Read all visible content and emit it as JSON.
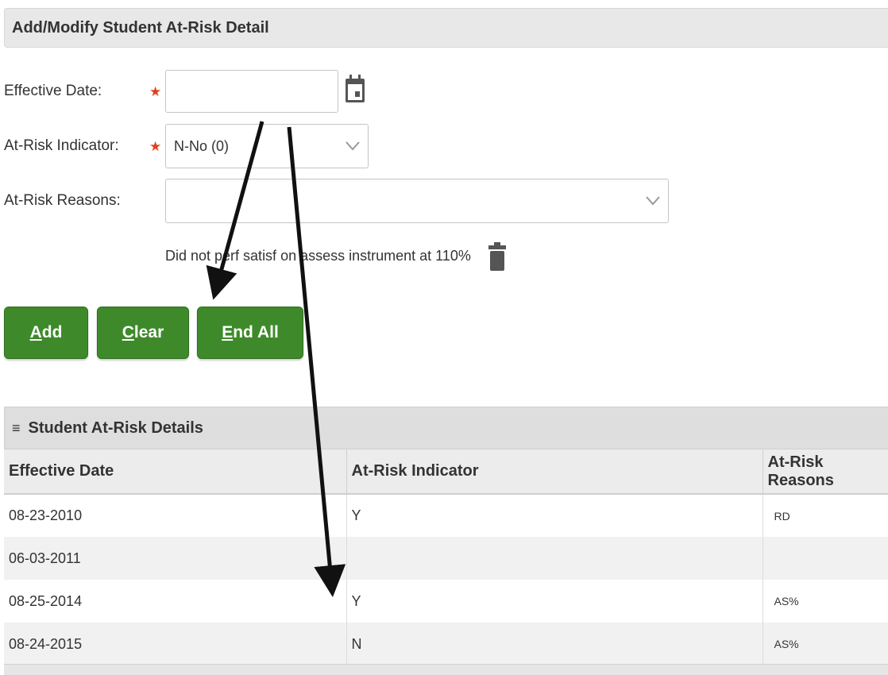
{
  "form": {
    "title": "Add/Modify Student At-Risk Detail",
    "effective_date": {
      "label": "Effective Date:",
      "value": ""
    },
    "indicator": {
      "label": "At-Risk Indicator:",
      "value": "N-No (0)"
    },
    "reasons": {
      "label": "At-Risk Reasons:",
      "value": "",
      "selected_reason": "Did not perf satisf on assess instrument at 110%"
    },
    "required_mark": "★"
  },
  "buttons": {
    "add": {
      "first": "A",
      "rest": "dd"
    },
    "clear": {
      "first": "C",
      "rest": "lear"
    },
    "end_all": {
      "first": "E",
      "rest": "nd All"
    }
  },
  "grid": {
    "title": "Student At-Risk Details",
    "menu_icon": "≡",
    "columns": [
      "Effective Date",
      "At-Risk Indicator",
      "At-Risk Reasons"
    ],
    "rows": [
      {
        "date": "08-23-2010",
        "indicator": "Y",
        "reasons": "RD"
      },
      {
        "date": "06-03-2011",
        "indicator": "",
        "reasons": ""
      },
      {
        "date": "08-25-2014",
        "indicator": "Y",
        "reasons": "AS%"
      },
      {
        "date": "08-24-2015",
        "indicator": "N",
        "reasons": "AS%"
      }
    ]
  },
  "colors": {
    "button_green": "#3e8a2a",
    "required_star": "#e2411c"
  },
  "icons": [
    "calendar-icon",
    "chevron-down-icon",
    "trash-icon",
    "menu-icon"
  ]
}
